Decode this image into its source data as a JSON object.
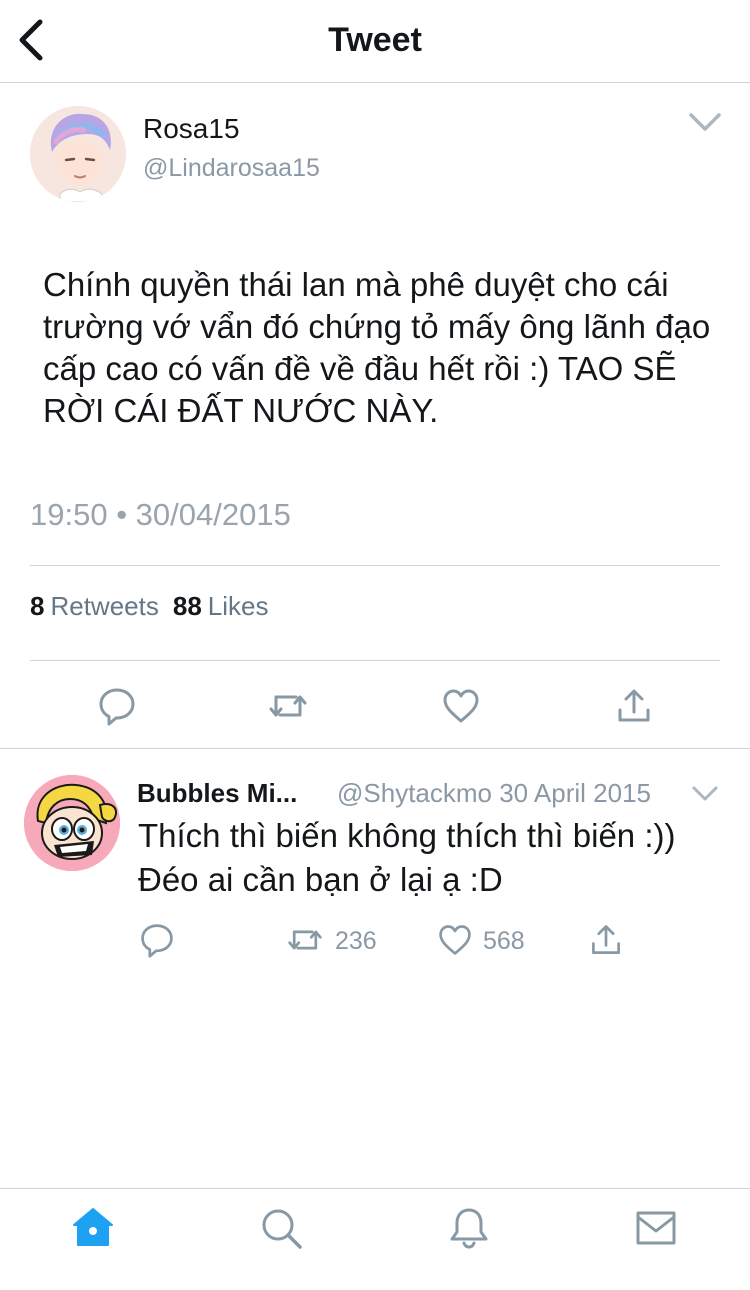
{
  "header": {
    "title": "Tweet",
    "back_icon": "back-chevron-icon"
  },
  "tweet": {
    "display_name": "Rosa15",
    "handle": "@Lindarosaa15",
    "text": "Chính quyền thái lan mà phê duyệt cho cái trường vớ vẩn đó chứng tỏ mấy ông lãnh đạo cấp cao có vấn đề về đầu hết rồi :) TAO SẼ RỜI CÁI ĐẤT NƯỚC NÀY.",
    "timestamp": "19:50 • 30/04/2015",
    "retweets_count": "8",
    "retweets_label": "Retweets",
    "likes_count": "88",
    "likes_label": "Likes",
    "actions": [
      "reply-icon",
      "retweet-icon",
      "like-icon",
      "share-icon"
    ]
  },
  "reply": {
    "display_name": "Bubbles Mi...",
    "handle_date": "@Shytackmo 30 April 2015",
    "text_line1": "Thích thì biến không thích thì biến :))",
    "text_line2": "Đéo ai cần bạn ở lại ạ :D",
    "retweets": "236",
    "likes": "568"
  },
  "tabbar": {
    "items": [
      "home-icon",
      "search-icon",
      "notifications-icon",
      "messages-icon"
    ],
    "active": "home-icon"
  },
  "colors": {
    "accent": "#1da1f2",
    "text": "#14171a",
    "secondary": "#8b98a5",
    "divider": "#d0d4d8",
    "icon": "#8899a6"
  }
}
